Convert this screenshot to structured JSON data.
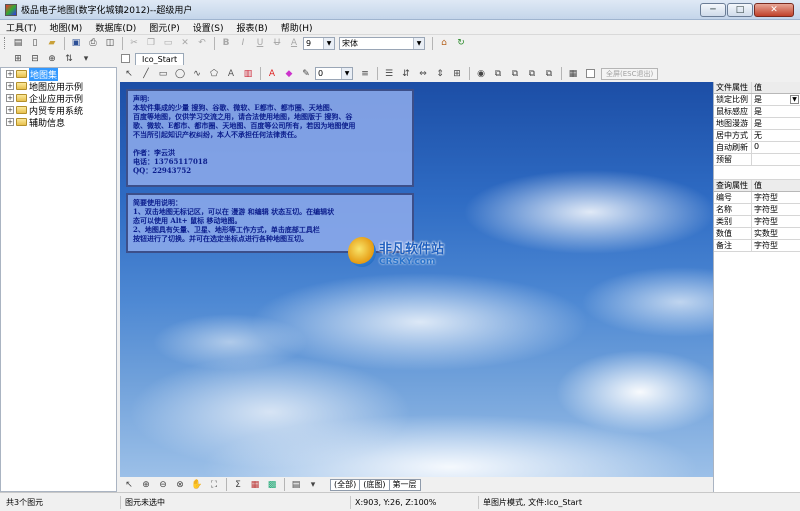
{
  "window": {
    "title": "极品电子地图(数字化城镇2012)--超级用户",
    "minimize": "─",
    "maximize": "□",
    "close": "✕"
  },
  "menu": [
    "工具(T)",
    "地图(M)",
    "数据库(D)",
    "图元(P)",
    "设置(S)",
    "报表(B)",
    "帮助(H)"
  ],
  "toolbar": {
    "font_size_value": "9",
    "font_name_value": "宋体",
    "line_width_value": "0",
    "fullscreen_label": "全屏(ESC退出)"
  },
  "tree": {
    "items": [
      {
        "label": "地图集",
        "selected": true
      },
      {
        "label": "地图应用示例",
        "selected": false
      },
      {
        "label": "企业应用示例",
        "selected": false
      },
      {
        "label": "内贸专用系统",
        "selected": false
      },
      {
        "label": "辅助信息",
        "selected": false
      }
    ]
  },
  "document_tab": {
    "label": "Ico_Start"
  },
  "note1": {
    "heading": "声明:",
    "lines": [
      "        本软件集成的少量 搜狗、谷歌、微软、E都市、都市圈、天地图、",
      "百度等地图，仅供学习交流之用，请合法使用地图，地图版于 搜狗、谷",
      "歌、微软、E都市、都市圈、天地图、百度等公司所有，若因为地图使用",
      "不当所引起知识产权纠纷，本人不承担任何法律责任。"
    ],
    "author": "作者：李云洪",
    "phone": "电话：13765117018",
    "qq": "QQ：22943752"
  },
  "note2": {
    "heading": "简要使用说明：",
    "lines": [
      "        1、双击地图无标记区，可以在 漫游 和编辑 状态互切。在编辑状",
      "态可以使用 Alt+ 鼠标 移动地图。",
      "        2、地图具有矢量、卫星、地形等工作方式，单击底部工具栏",
      "按钮进行了切换。并可在选定坐标点进行各种地图互切。"
    ]
  },
  "watermark": {
    "title": "非凡软件站",
    "subtitle": "CRSKY.com"
  },
  "props": {
    "file_header": {
      "key": "文件属性",
      "value": "值"
    },
    "file_rows": [
      {
        "key": "锁定比例",
        "value": "是",
        "dropdown": true
      },
      {
        "key": "鼠标感应",
        "value": "是",
        "dropdown": false
      },
      {
        "key": "地图漫游",
        "value": "是",
        "dropdown": false
      },
      {
        "key": "居中方式",
        "value": "无",
        "dropdown": false
      },
      {
        "key": "自动刷新",
        "value": "0",
        "dropdown": false
      },
      {
        "key": "预留",
        "value": "",
        "dropdown": false
      }
    ],
    "query_header": {
      "key": "查询属性",
      "value": "值"
    },
    "query_rows": [
      {
        "key": "编号",
        "value": "字符型"
      },
      {
        "key": "名称",
        "value": "字符型"
      },
      {
        "key": "类别",
        "value": "字符型"
      },
      {
        "key": "数值",
        "value": "实数型"
      },
      {
        "key": "备注",
        "value": "字符型"
      }
    ]
  },
  "layer_tabs": [
    "(全部)",
    "(底图)",
    "第一层"
  ],
  "status": {
    "count": "共3个图元",
    "selection": "图元未选中",
    "coords": "X:903, Y:26, Z:100%",
    "mode": "单图片模式, 文件:Ico_Start"
  }
}
